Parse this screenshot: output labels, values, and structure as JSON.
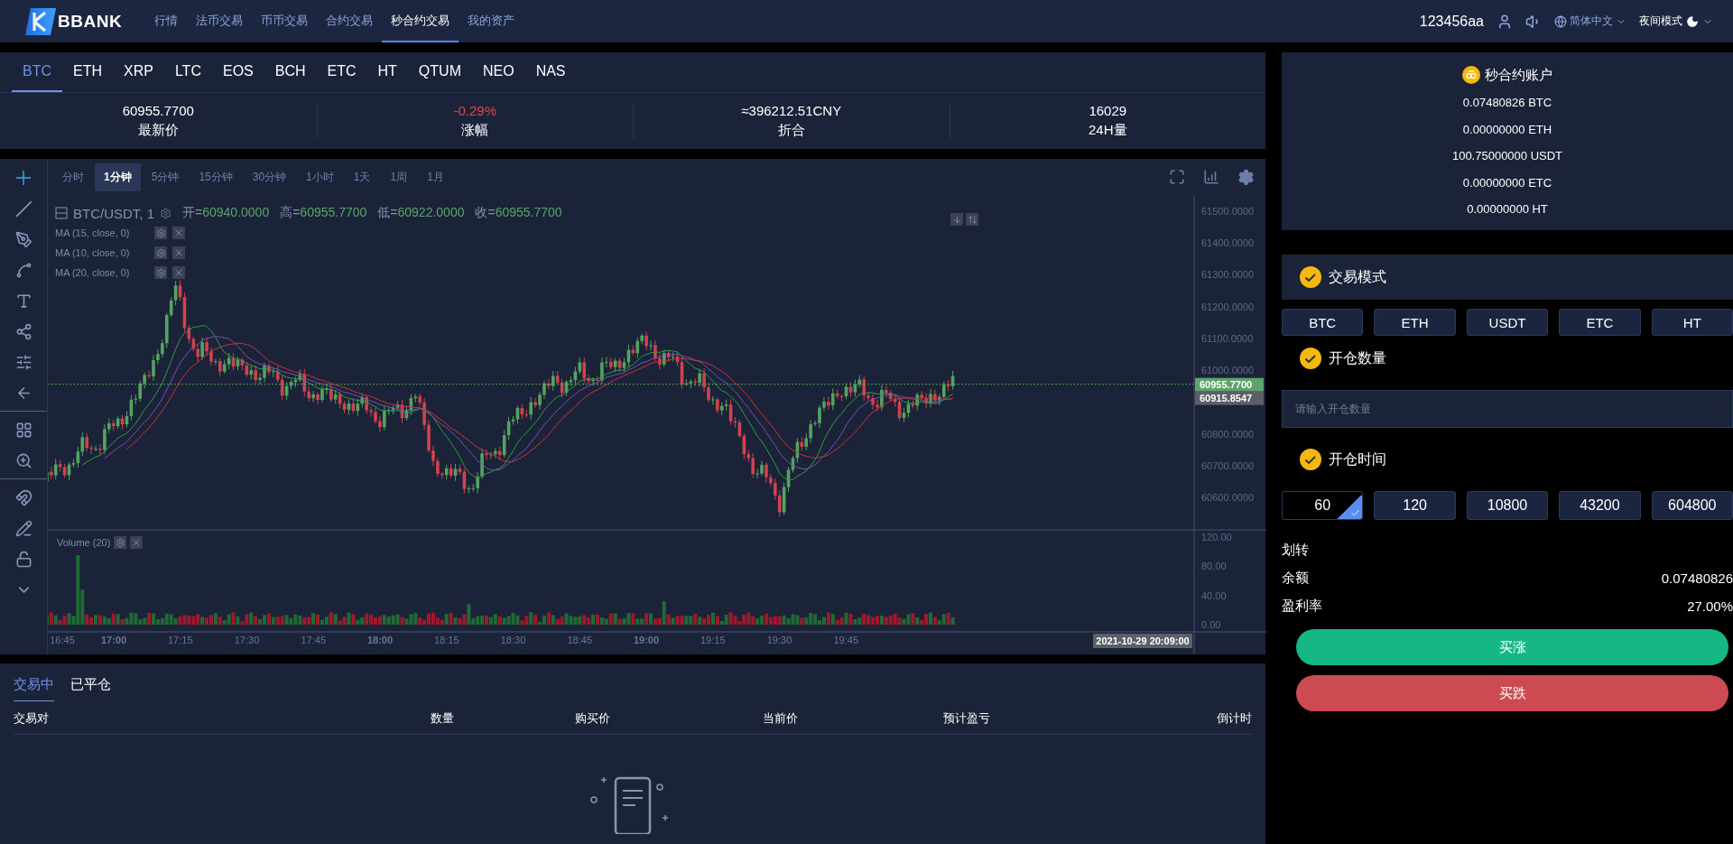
{
  "header": {
    "logo": "BBANK",
    "nav": [
      {
        "label": "行情",
        "selected": false
      },
      {
        "label": "法币交易",
        "selected": false
      },
      {
        "label": "币币交易",
        "selected": false
      },
      {
        "label": "合约交易",
        "selected": false
      },
      {
        "label": "秒合约交易",
        "selected": true
      },
      {
        "label": "我的资产",
        "selected": false
      }
    ],
    "user": "123456aa",
    "language": "简体中文",
    "theme": "夜间模式"
  },
  "coin_tabs": [
    {
      "label": "BTC",
      "selected": true
    },
    {
      "label": "ETH",
      "selected": false
    },
    {
      "label": "XRP",
      "selected": false
    },
    {
      "label": "LTC",
      "selected": false
    },
    {
      "label": "EOS",
      "selected": false
    },
    {
      "label": "BCH",
      "selected": false
    },
    {
      "label": "ETC",
      "selected": false
    },
    {
      "label": "HT",
      "selected": false
    },
    {
      "label": "QTUM",
      "selected": false
    },
    {
      "label": "NEO",
      "selected": false
    },
    {
      "label": "NAS",
      "selected": false
    }
  ],
  "stats": [
    {
      "value": "60955.7700",
      "label": "最新价",
      "kind": "plain"
    },
    {
      "value": "-0.29%",
      "label": "涨幅",
      "kind": "down"
    },
    {
      "value": "≈396212.51CNY",
      "label": "折合",
      "kind": "plain"
    },
    {
      "value": "16029",
      "label": "24H量",
      "kind": "plain"
    }
  ],
  "chart": {
    "intervals": [
      {
        "label": "分时",
        "selected": false
      },
      {
        "label": "1分钟",
        "selected": true
      },
      {
        "label": "5分钟",
        "selected": false
      },
      {
        "label": "15分钟",
        "selected": false
      },
      {
        "label": "30分钟",
        "selected": false
      },
      {
        "label": "1小时",
        "selected": false
      },
      {
        "label": "1天",
        "selected": false
      },
      {
        "label": "1周",
        "selected": false
      },
      {
        "label": "1月",
        "selected": false
      }
    ],
    "symbol": "BTC/USDT, 1",
    "ohlc": [
      {
        "label": "开=",
        "value": "60940.0000"
      },
      {
        "label": "高=",
        "value": "60955.7700"
      },
      {
        "label": "低=",
        "value": "60922.0000"
      },
      {
        "label": "收=",
        "value": "60955.7700"
      }
    ],
    "indicators": [
      "MA (15, close, 0)",
      "MA (10, close, 0)",
      "MA (20, close, 0)"
    ],
    "price_ticks": [
      "61500.0000",
      "61400.0000",
      "61300.0000",
      "61200.0000",
      "61100.0000",
      "61000.0000",
      "60800.0000",
      "60700.0000",
      "60600.0000"
    ],
    "last_price": "60955.7700",
    "ma_price": "60915.8547",
    "volume_label": "Volume (20)",
    "volume_ticks": [
      "120.00",
      "80.00",
      "40.00",
      "0.00"
    ],
    "time_labels": [
      {
        "label": "16:45",
        "bold": false
      },
      {
        "label": "17:00",
        "bold": true
      },
      {
        "label": "17:15",
        "bold": false
      },
      {
        "label": "17:30",
        "bold": false
      },
      {
        "label": "17:45",
        "bold": false
      },
      {
        "label": "18:00",
        "bold": true
      },
      {
        "label": "18:15",
        "bold": false
      },
      {
        "label": "18:30",
        "bold": false
      },
      {
        "label": "18:45",
        "bold": false
      },
      {
        "label": "19:00",
        "bold": true
      },
      {
        "label": "19:15",
        "bold": false
      },
      {
        "label": "19:30",
        "bold": false
      },
      {
        "label": "19:45",
        "bold": false
      }
    ],
    "cursor_time": "2021-10-29 20:09:00"
  },
  "account": {
    "title": "秒合约账户",
    "balances": [
      "0.07480826 BTC",
      "0.00000000 ETH",
      "100.75000000 USDT",
      "0.00000000 ETC",
      "0.00000000 HT"
    ]
  },
  "trade_mode": {
    "title": "交易模式",
    "options": [
      "BTC",
      "ETH",
      "USDT",
      "ETC",
      "HT"
    ]
  },
  "amount": {
    "title": "开仓数量",
    "placeholder": "请输入开仓数量"
  },
  "duration": {
    "title": "开仓时间",
    "options": [
      {
        "label": "60",
        "selected": true
      },
      {
        "label": "120",
        "selected": false
      },
      {
        "label": "10800",
        "selected": false
      },
      {
        "label": "43200",
        "selected": false
      },
      {
        "label": "604800",
        "selected": false
      }
    ]
  },
  "transfer": "划转",
  "summary": [
    {
      "label": "余额",
      "value": "0.07480826"
    },
    {
      "label": "盈利率",
      "value": "27.00%"
    }
  ],
  "actions": [
    {
      "label": "买涨",
      "kind": "up"
    },
    {
      "label": "买跌",
      "kind": "down"
    }
  ],
  "orders": {
    "tabs": [
      {
        "label": "交易中",
        "selected": true
      },
      {
        "label": "已平仓",
        "selected": false
      }
    ],
    "columns": [
      "交易对",
      "数量",
      "购买价",
      "当前价",
      "预计盈亏",
      "倒计时"
    ]
  }
}
